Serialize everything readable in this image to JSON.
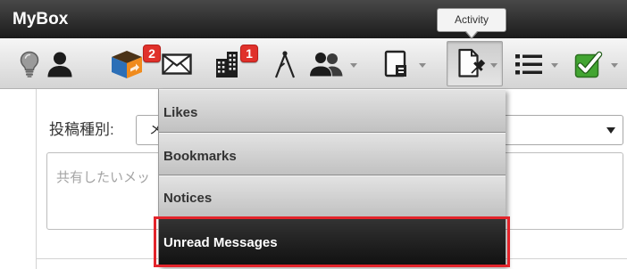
{
  "header": {
    "title": "MyBox"
  },
  "tooltip": {
    "text": "Activity"
  },
  "toolbar": {
    "buttons": [
      {
        "icon": "lightbulb-icon"
      },
      {
        "icon": "person-icon"
      },
      {
        "icon": "box-icon",
        "badge": "2"
      },
      {
        "icon": "envelope-icon"
      },
      {
        "icon": "building-icon",
        "badge": "1"
      },
      {
        "icon": "compass-icon"
      },
      {
        "icon": "people-icon",
        "dropdown": true
      },
      {
        "icon": "contact-card-icon",
        "dropdown": true
      },
      {
        "icon": "activity-icon",
        "dropdown": true,
        "active": true
      },
      {
        "icon": "list-icon",
        "dropdown": true
      },
      {
        "icon": "check-icon",
        "dropdown": true
      }
    ]
  },
  "form": {
    "post_type_label": "投稿種別:",
    "post_type_value": "メ",
    "message_placeholder": "共有したいメッ"
  },
  "menu": {
    "items": [
      {
        "label": "Likes"
      },
      {
        "label": "Bookmarks"
      },
      {
        "label": "Notices"
      },
      {
        "label": "Unread Messages",
        "highlighted": true
      }
    ]
  },
  "colors": {
    "header_background": "#2a2a2a",
    "badge_background": "#e0312b",
    "highlight_border": "#e3242b",
    "highlight_background": "#1e1e1e",
    "check_green": "#43a532"
  }
}
